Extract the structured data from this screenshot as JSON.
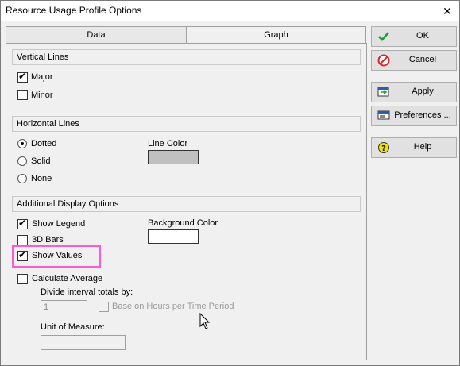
{
  "window": {
    "title": "Resource Usage Profile Options"
  },
  "tabs": [
    {
      "label": "Data",
      "active": false
    },
    {
      "label": "Graph",
      "active": true
    }
  ],
  "vertical_lines": {
    "header": "Vertical Lines",
    "major": {
      "label": "Major",
      "checked": true
    },
    "minor": {
      "label": "Minor",
      "checked": false
    }
  },
  "horizontal_lines": {
    "header": "Horizontal Lines",
    "options": [
      {
        "label": "Dotted",
        "selected": true
      },
      {
        "label": "Solid",
        "selected": false
      },
      {
        "label": "None",
        "selected": false
      }
    ],
    "line_color_label": "Line Color",
    "line_color": "#c0c0c0"
  },
  "additional": {
    "header": "Additional Display Options",
    "show_legend": {
      "label": "Show Legend",
      "checked": true
    },
    "bars_3d": {
      "label": "3D Bars",
      "checked": false
    },
    "show_values": {
      "label": "Show Values",
      "checked": true
    },
    "calculate_average": {
      "label": "Calculate Average",
      "checked": false
    },
    "background_color_label": "Background Color",
    "background_color": "#ffffff",
    "divide_label": "Divide interval totals by:",
    "divide_value": "1",
    "base_on_hours": {
      "label": "Base on Hours per Time Period",
      "checked": false
    },
    "unit_label": "Unit of Measure:",
    "unit_value": ""
  },
  "buttons": {
    "ok": "OK",
    "cancel": "Cancel",
    "apply": "Apply",
    "preferences": "Preferences ...",
    "help": "Help"
  },
  "colors": {
    "highlight": "#ff5bd0",
    "ok_check": "#1f9a3a",
    "cancel_red": "#d42a2a"
  }
}
